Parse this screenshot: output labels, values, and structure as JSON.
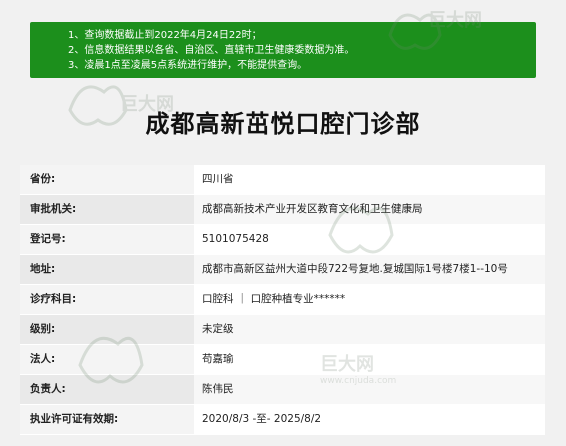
{
  "notice": {
    "lines": [
      "1、查询数据截止到2022年4月24日22时；",
      "2、信息数据结果以各省、自治区、直辖市卫生健康委数据为准。",
      "3、凌晨1点至凌晨5点系统进行维护，不能提供查询。"
    ]
  },
  "title": "成都高新茁悦口腔门诊部",
  "rows": [
    {
      "label": "省份:",
      "value": "四川省"
    },
    {
      "label": "审批机关:",
      "value": "成都高新技术产业开发区教育文化和卫生健康局"
    },
    {
      "label": "登记号:",
      "value": "5101075428"
    },
    {
      "label": "地址:",
      "value": "成都市高新区益州大道中段722号复地.复城国际1号楼7楼1--10号"
    },
    {
      "label": "诊疗科目:",
      "value": "口腔科 ｜ 口腔种植专业******"
    },
    {
      "label": "级别:",
      "value": "未定级"
    },
    {
      "label": "法人:",
      "value": "苟嘉瑜"
    },
    {
      "label": "负责人:",
      "value": "陈伟民"
    },
    {
      "label": "执业许可证有效期:",
      "value": "2020/8/3 -至- 2025/8/2"
    }
  ],
  "watermark": {
    "brand": "巨大网",
    "url": "www.cnjuda.com"
  },
  "colors": {
    "notice_bg": "#1c8f1c",
    "page_bg": "#f1f1f1"
  }
}
